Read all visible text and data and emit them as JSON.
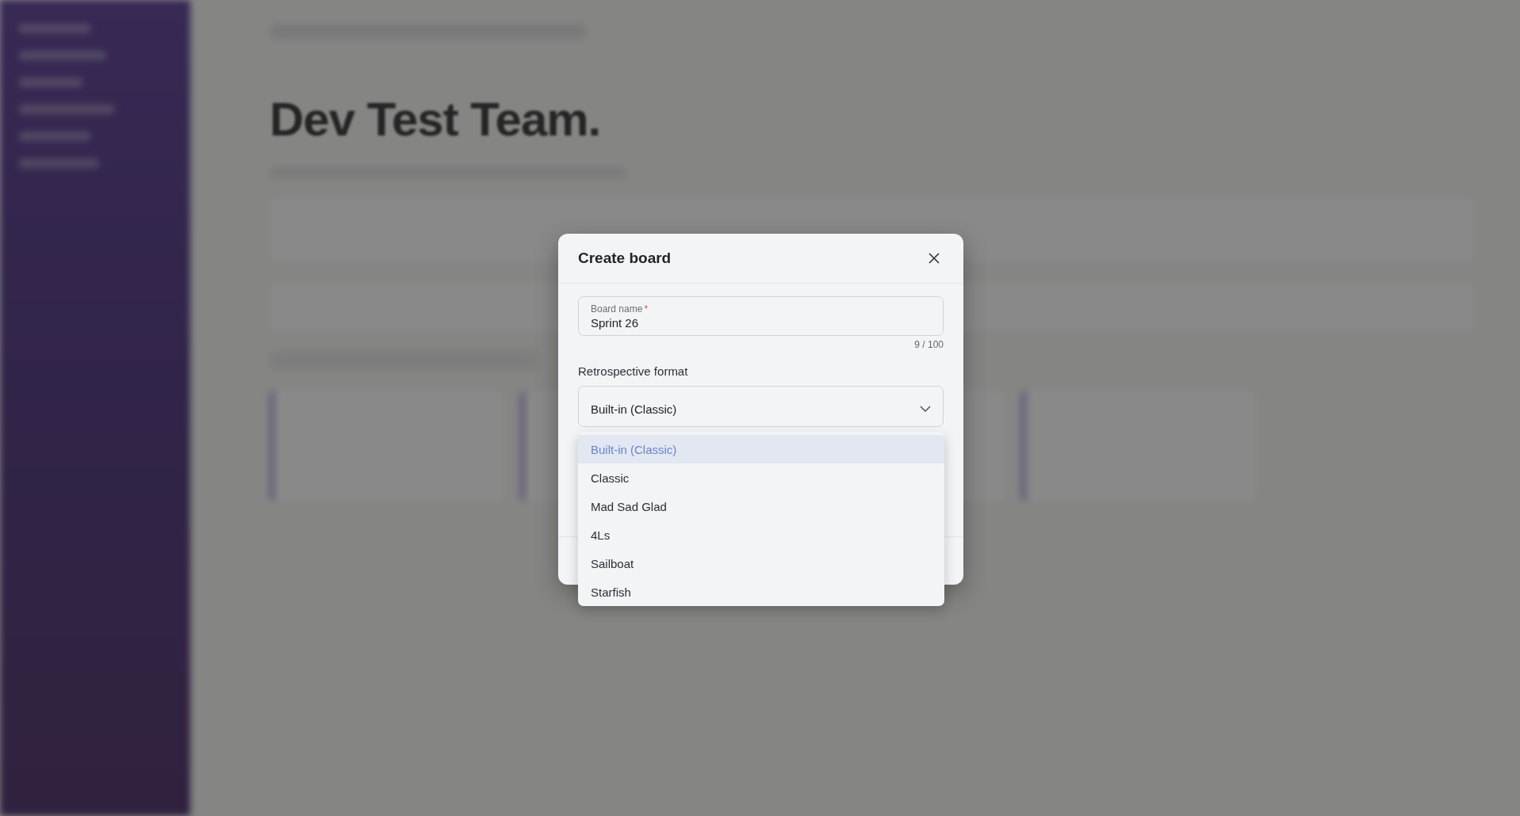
{
  "background": {
    "heading": "Dev Test Team."
  },
  "dialog": {
    "title": "Create board",
    "board_name": {
      "label": "Board name",
      "required_mark": "*",
      "value": "Sprint 26",
      "counter": "9 / 100"
    },
    "format": {
      "label": "Retrospective format",
      "value": "Built-in (Classic)",
      "expanded": true,
      "options": [
        {
          "label": "Built-in (Classic)",
          "selected": true
        },
        {
          "label": "Classic",
          "selected": false
        },
        {
          "label": "Mad Sad Glad",
          "selected": false
        },
        {
          "label": "4Ls",
          "selected": false
        },
        {
          "label": "Sailboat",
          "selected": false
        },
        {
          "label": "Starfish",
          "selected": false
        }
      ]
    }
  }
}
